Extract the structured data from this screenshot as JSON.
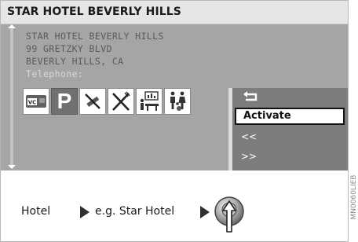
{
  "title": "STAR HOTEL BEVERLY HILLS",
  "address": {
    "line1": "STAR HOTEL BEVERLY HILLS",
    "line2": "99 GRETZKY BLVD",
    "line3": "BEVERLY HILLS, CA",
    "telephone_label": "Telephone:"
  },
  "amenity_icons": [
    {
      "name": "credit-card-icon",
      "text": "VC"
    },
    {
      "name": "parking-icon",
      "text": "P"
    },
    {
      "name": "no-smoking-icon"
    },
    {
      "name": "restaurant-icon"
    },
    {
      "name": "conference-room-icon"
    },
    {
      "name": "family-icon"
    }
  ],
  "menu": {
    "back_symbol": "↩",
    "activate": "Activate",
    "previous": "<<",
    "next": ">>"
  },
  "caption": {
    "part1": "Hotel",
    "part2": "e.g. Star Hotel"
  },
  "figure_code": "MN0060LIEB",
  "colors": {
    "screen": "#a5a5a5",
    "menu_panel": "#7d7d7d",
    "title_bar": "#e6e6e6",
    "telephone_text": "#dadada"
  }
}
